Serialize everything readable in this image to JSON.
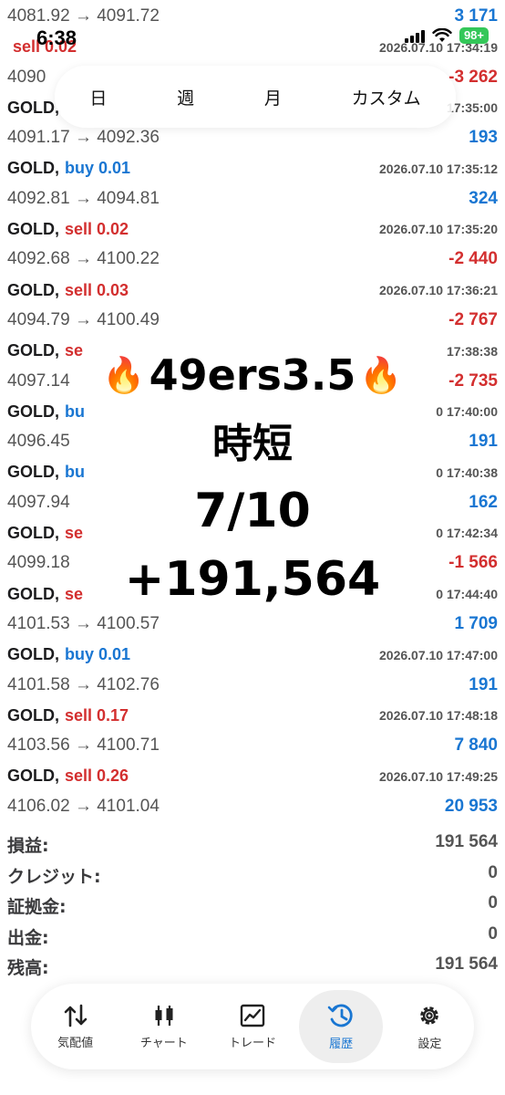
{
  "status_bar": {
    "time": "6:38",
    "battery": "98+"
  },
  "period_tabs": [
    {
      "label": "日",
      "active": false
    },
    {
      "label": "週",
      "active": false
    },
    {
      "label": "月",
      "active": false
    },
    {
      "label": "カスタム",
      "active": false
    }
  ],
  "deals": [
    {
      "symbol": "",
      "side": "",
      "time": "",
      "prices": "4081.92 → 4091.72",
      "profit": "3 171",
      "profit_sign": "pos"
    },
    {
      "symbol": "",
      "side": "sell 0.02",
      "time": "2026.07.10 17:34:19",
      "prices": "4090",
      "profit": "-3 262",
      "profit_sign": "neg"
    },
    {
      "symbol": "GOLD,",
      "side": "",
      "time": "17:35:00",
      "prices": "4091.17 → 4092.36",
      "profit": "193",
      "profit_sign": "pos"
    },
    {
      "symbol": "GOLD,",
      "side": "buy 0.01",
      "side_type": "buy",
      "time": "2026.07.10 17:35:12",
      "prices": "4092.81 → 4094.81",
      "profit": "324",
      "profit_sign": "pos"
    },
    {
      "symbol": "GOLD,",
      "side": "sell 0.02",
      "side_type": "sell",
      "time": "2026.07.10 17:35:20",
      "prices": "4092.68 → 4100.22",
      "profit": "-2 440",
      "profit_sign": "neg"
    },
    {
      "symbol": "GOLD,",
      "side": "sell 0.03",
      "side_type": "sell",
      "time": "2026.07.10 17:36:21",
      "prices": "4094.79 → 4100.49",
      "profit": "-2 767",
      "profit_sign": "neg"
    },
    {
      "symbol": "GOLD,",
      "side": "se",
      "side_type": "sell",
      "time": "17:38:38",
      "prices": "4097.14",
      "profit": "-2 735",
      "profit_sign": "neg"
    },
    {
      "symbol": "GOLD,",
      "side": "bu",
      "side_type": "buy",
      "time": "0 17:40:00",
      "prices": "4096.45",
      "profit": "191",
      "profit_sign": "pos"
    },
    {
      "symbol": "GOLD,",
      "side": "bu",
      "side_type": "buy",
      "time": "0 17:40:38",
      "prices": "4097.94",
      "profit": "162",
      "profit_sign": "pos"
    },
    {
      "symbol": "GOLD,",
      "side": "se",
      "side_type": "sell",
      "time": "0 17:42:34",
      "prices": "4099.18",
      "profit": "-1 566",
      "profit_sign": "neg"
    },
    {
      "symbol": "GOLD,",
      "side": "se",
      "side_type": "sell",
      "time": "0 17:44:40",
      "prices": "4101.53 → 4100.57",
      "profit": "1 709",
      "profit_sign": "pos"
    },
    {
      "symbol": "GOLD,",
      "side": "buy 0.01",
      "side_type": "buy",
      "time": "2026.07.10 17:47:00",
      "prices": "4101.58 → 4102.76",
      "profit": "191",
      "profit_sign": "pos"
    },
    {
      "symbol": "GOLD,",
      "side": "sell 0.17",
      "side_type": "sell",
      "time": "2026.07.10 17:48:18",
      "prices": "4103.56 → 4100.71",
      "profit": "7 840",
      "profit_sign": "pos"
    },
    {
      "symbol": "GOLD,",
      "side": "sell 0.26",
      "side_type": "sell",
      "time": "2026.07.10 17:49:25",
      "prices": "4106.02 → 4101.04",
      "profit": "20 953",
      "profit_sign": "pos"
    }
  ],
  "summary": [
    {
      "label": "損益:",
      "value": "191 564"
    },
    {
      "label": "クレジット:",
      "value": "0"
    },
    {
      "label": "証拠金:",
      "value": "0"
    },
    {
      "label": "出金:",
      "value": "0"
    },
    {
      "label": "残高:",
      "value": "191 564"
    }
  ],
  "overlay": {
    "title": "49ers3.5",
    "subtitle": "時短",
    "date": "7/10",
    "amount": "+191,564"
  },
  "tabs": [
    {
      "label": "気配値",
      "icon": "quotes-icon",
      "active": false
    },
    {
      "label": "チャート",
      "icon": "candlestick-chart-icon",
      "active": false
    },
    {
      "label": "トレード",
      "icon": "trade-chart-icon",
      "active": false
    },
    {
      "label": "履歴",
      "icon": "history-icon",
      "active": true
    },
    {
      "label": "設定",
      "icon": "gear-icon",
      "active": false
    }
  ],
  "colors": {
    "buy": "#1976d2",
    "sell": "#d32f2f",
    "active_tab": "#1976d2",
    "battery": "#34c759"
  }
}
